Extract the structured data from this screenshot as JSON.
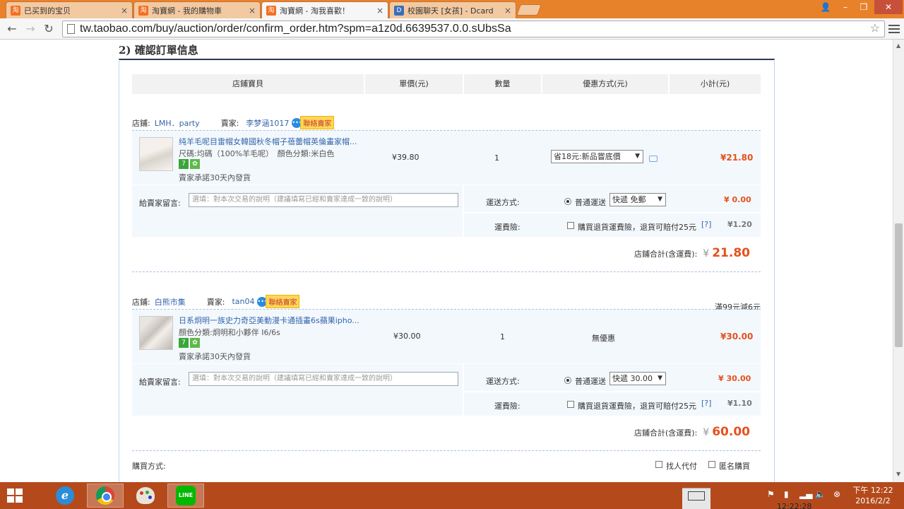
{
  "browser": {
    "tabs": [
      {
        "title": "已买到的宝贝",
        "icon": "taobao-favicon"
      },
      {
        "title": "淘寶網 - 我的購物車",
        "icon": "taobao-favicon"
      },
      {
        "title": "淘寶網 - 淘我喜歡！",
        "icon": "taobao-favicon",
        "active": true
      },
      {
        "title": "校園聊天 [女孩] - Dcard",
        "icon": "dcard-favicon"
      }
    ],
    "url": "tw.taobao.com/buy/auction/order/confirm_order.htm?spm=a1z0d.6639537.0.0.sUbsSa"
  },
  "page": {
    "section_title": "2) 確認訂單信息",
    "columns": [
      "店鋪寶貝",
      "單價(元)",
      "數量",
      "優惠方式(元)",
      "小計(元)"
    ]
  },
  "labels": {
    "shop": "店鋪:",
    "seller": "賣家:",
    "contact_seller": "聯絡賣家",
    "message_to_seller": "給賣家留言:",
    "message_placeholder": "選填：對本次交易的說明（建議填寫已經和賣家達成一致的說明）",
    "shipping_method": "運送方式:",
    "shipping_insurance": "運費險:",
    "normal_shipping": "普通運送",
    "return_insurance": "購買退貨運費險，退貨可賠付25元",
    "help": "[?]",
    "shop_total": "店鋪合計(含運費):",
    "yen": "¥",
    "purchase_method": "購買方式:",
    "proxy_pay": "找人代付",
    "anonymous": "匿名購買"
  },
  "orders": [
    {
      "shop_name": "LMH．party",
      "seller_name": "李梦涵1017",
      "item_title": "纯羊毛呢目雷帽女韓國秋冬帽子蓓蕾帽英倫畫家帽...",
      "item_spec": "尺碼:均碼（100%羊毛呢）　顏色分類:米白色",
      "promise": "賣家承諾30天內發貨",
      "unit_price": "¥39.80",
      "quantity": "1",
      "discount": "省18元:新品嘗底價",
      "subtotal": "¥21.80",
      "shipping_option": "快遞 免郵",
      "shipping_fee": "¥ 0.00",
      "insurance_fee": "¥1.20",
      "total": "21.80"
    },
    {
      "shop_name": "白熊市集",
      "seller_name": "tan04",
      "promo_note": "滿99元減6元",
      "item_title": "日系炯明一族史力奇亞美動漫卡通插畫6s蘋果ipho...",
      "item_spec": "顏色分類:炯明和小夥伴 I6/6s",
      "promise": "賣家承諾30天內發貨",
      "unit_price": "¥30.00",
      "quantity": "1",
      "discount": "無優惠",
      "subtotal": "¥30.00",
      "shipping_option": "快遞 30.00",
      "shipping_fee": "¥ 30.00",
      "insurance_fee": "¥1.10",
      "total": "60.00"
    }
  ],
  "taskbar": {
    "clock_time": "下午 12:22",
    "clock_date": "2016/2/2",
    "clock_overlay": "12:22:28",
    "line_label": "LINE"
  }
}
